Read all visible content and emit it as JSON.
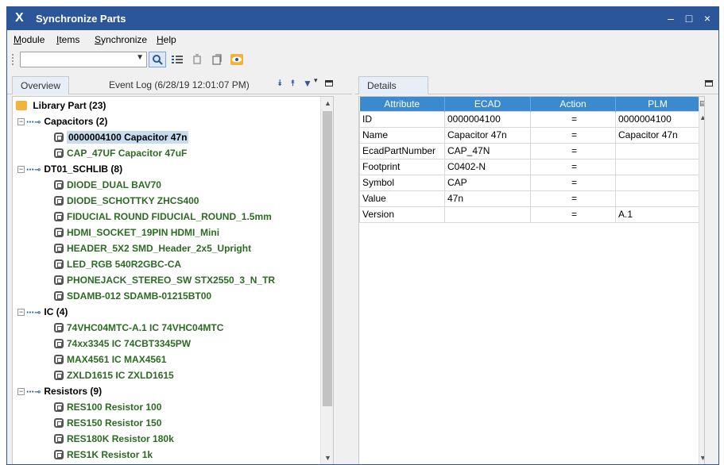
{
  "window": {
    "title": "Synchronize Parts",
    "logo": "X"
  },
  "window_controls": {
    "minimize": "–",
    "maximize": "□",
    "close": "×"
  },
  "menu": [
    {
      "label": "Module",
      "accel": "M",
      "rest": "odule"
    },
    {
      "label": "Items",
      "accel": "I",
      "rest": "tems"
    },
    {
      "label": "Synchronize",
      "accel": "S",
      "rest": "ynchronize"
    },
    {
      "label": "Help",
      "accel": "H",
      "rest": "elp"
    }
  ],
  "toolbar": {
    "combo_value": "",
    "icons": [
      "search-icon",
      "list-icon",
      "refresh-icon",
      "copy-icon",
      "eye-icon"
    ]
  },
  "left": {
    "tabs": [
      "Overview",
      "Event Log (6/28/19 12:01:07 PM)"
    ],
    "root": "Library Part (23)",
    "rows": [
      {
        "type": "group",
        "label": "Capacitors (2)"
      },
      {
        "type": "leaf",
        "label": "0000004100 Capacitor 47n",
        "selected": true
      },
      {
        "type": "leaf",
        "label": "CAP_47UF Capacitor 47uF"
      },
      {
        "type": "group",
        "label": "DT01_SCHLIB (8)"
      },
      {
        "type": "leaf",
        "label": "DIODE_DUAL BAV70"
      },
      {
        "type": "leaf",
        "label": "DIODE_SCHOTTKY ZHCS400"
      },
      {
        "type": "leaf",
        "label": "FIDUCIAL ROUND FIDUCIAL_ROUND_1.5mm"
      },
      {
        "type": "leaf",
        "label": "HDMI_SOCKET_19PIN HDMI_Mini"
      },
      {
        "type": "leaf",
        "label": "HEADER_5X2 SMD_Header_2x5_Upright"
      },
      {
        "type": "leaf",
        "label": "LED_RGB 540R2GBC-CA"
      },
      {
        "type": "leaf",
        "label": "PHONEJACK_STEREO_SW STX2550_3_N_TR"
      },
      {
        "type": "leaf",
        "label": "SDAMB-012 SDAMB-01215BT00"
      },
      {
        "type": "group",
        "label": "IC (4)"
      },
      {
        "type": "leaf",
        "label": "74VHC04MTC-A.1 IC 74VHC04MTC"
      },
      {
        "type": "leaf",
        "label": "74xx3345 IC 74CBT3345PW"
      },
      {
        "type": "leaf",
        "label": "MAX4561 IC MAX4561"
      },
      {
        "type": "leaf",
        "label": "ZXLD1615 IC ZXLD1615"
      },
      {
        "type": "group",
        "label": "Resistors (9)"
      },
      {
        "type": "leaf",
        "label": "RES100 Resistor 100"
      },
      {
        "type": "leaf",
        "label": "RES150 Resistor 150"
      },
      {
        "type": "leaf",
        "label": "RES180K Resistor 180k"
      },
      {
        "type": "leaf",
        "label": "RES1K Resistor 1k"
      }
    ]
  },
  "right": {
    "tab": "Details",
    "columns": [
      "Attribute",
      "ECAD",
      "Action",
      "PLM"
    ],
    "rows": [
      {
        "attr": "ID",
        "ecad": "0000004100",
        "action": "=",
        "plm": "0000004100"
      },
      {
        "attr": "Name",
        "ecad": "Capacitor 47n",
        "action": "=",
        "plm": "Capacitor 47n"
      },
      {
        "attr": "EcadPartNumber",
        "ecad": "CAP_47N",
        "action": "=",
        "plm": ""
      },
      {
        "attr": "Footprint",
        "ecad": "C0402-N",
        "action": "=",
        "plm": ""
      },
      {
        "attr": "Symbol",
        "ecad": "CAP",
        "action": "=",
        "plm": ""
      },
      {
        "attr": "Value",
        "ecad": "47n",
        "action": "=",
        "plm": ""
      },
      {
        "attr": "Version",
        "ecad": "",
        "action": "=",
        "plm": "A.1"
      }
    ]
  },
  "colors": {
    "titlebar": "#2b579a",
    "header": "#3b8ad0",
    "part_text": "#2c6b23",
    "selection": "#c7dcef"
  }
}
